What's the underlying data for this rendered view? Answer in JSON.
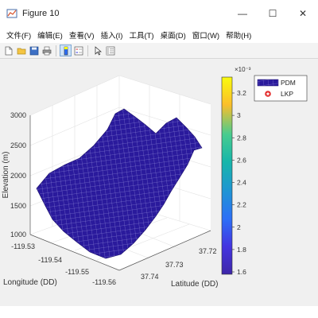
{
  "window": {
    "title": "Figure 10",
    "minimize": "—",
    "maximize": "☐",
    "close": "✕"
  },
  "menu": [
    {
      "label": "文件(F)"
    },
    {
      "label": "编辑(E)"
    },
    {
      "label": "查看(V)"
    },
    {
      "label": "插入(I)"
    },
    {
      "label": "工具(T)"
    },
    {
      "label": "桌面(D)"
    },
    {
      "label": "窗口(W)"
    },
    {
      "label": "帮助(H)"
    }
  ],
  "toolbar": [
    "new-file-icon",
    "open-folder-icon",
    "save-icon",
    "print-icon",
    "colorbar-toggle-icon",
    "legend-toggle-icon",
    "pointer-icon",
    "property-inspector-icon"
  ],
  "chart_data": {
    "type": "surface3d",
    "zlabel": "Elevation (m)",
    "xlabel": "Longitude (DD)",
    "ylabel": "Latitude (DD)",
    "zticks": [
      "1000",
      "1500",
      "2000",
      "2500",
      "3000"
    ],
    "zlim": [
      1000,
      3000
    ],
    "xticks": [
      "-119.53",
      "-119.54",
      "-119.55",
      "-119.56"
    ],
    "yticks": [
      "37.72",
      "37.73",
      "37.74"
    ],
    "colorbar": {
      "exponent": "×10⁻³",
      "ticks": [
        "3.2",
        "3",
        "2.8",
        "2.6",
        "2.4",
        "2.2",
        "2",
        "1.8",
        "1.6"
      ],
      "colors": [
        "#f9fb0e",
        "#fbbe2b",
        "#48cc8f",
        "#17b6aa",
        "#1f94d4",
        "#2c6ff7",
        "#4434e0",
        "#3e26a8"
      ]
    },
    "legend": {
      "placement": "top-right",
      "entries": [
        {
          "label": "PDM",
          "color": "#2a1a9c"
        },
        {
          "label": "LKP",
          "color": "#e32a2a"
        }
      ]
    },
    "surface_color": "#2a1a9c",
    "grid": true
  }
}
